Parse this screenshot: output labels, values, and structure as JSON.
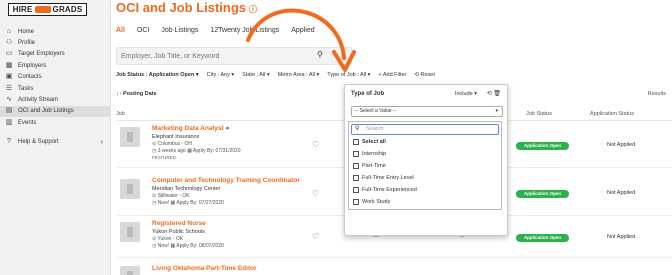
{
  "logo": {
    "left": "HIRE",
    "right": "GRADS"
  },
  "nav": [
    {
      "label": "Home",
      "icon": "⌂"
    },
    {
      "label": "Profile",
      "icon": "⚇"
    },
    {
      "label": "Target Employers",
      "icon": "▭"
    },
    {
      "label": "Employers",
      "icon": "▦"
    },
    {
      "label": "Contacts",
      "icon": "▣"
    },
    {
      "label": "Tasks",
      "icon": "☰"
    },
    {
      "label": "Activity Stream",
      "icon": "∿"
    },
    {
      "label": "OCI and Job Listings",
      "icon": "▤"
    },
    {
      "label": "Events",
      "icon": "▥"
    },
    {
      "label": "Help & Support",
      "icon": "?",
      "chevron": "›"
    }
  ],
  "page": {
    "title": "OCI and Job Listings",
    "info_icon": "ⓘ"
  },
  "tabs": [
    "All",
    "OCI",
    "Job Listings",
    "12Twenty Job Listings",
    "Applied"
  ],
  "search": {
    "placeholder": "Employer, Job Title, or Keyword"
  },
  "filters": {
    "job_status": "Job Status : Application Open ▾",
    "city": "City : Any ▾",
    "state": "State : All ▾",
    "metro": "Metro Area : All ▾",
    "type": "Type of Job : All ▾",
    "add": "+ Add Filter",
    "reset": "⟲ Reset"
  },
  "sort": {
    "label": "↓↑  Posting Date"
  },
  "results_label": "Results",
  "table": {
    "col_job": "Job",
    "col_job_status": "Job Status",
    "col_app_status": "Application Status"
  },
  "rows": [
    {
      "title": "Marketing Data Analyst",
      "employer": "Elephant Insurance",
      "location": "⊙ Columbus - OH",
      "meta": "◷ 3 weeks ago   ▦ Apply By: 07/31/2020",
      "badge": "FEATURED",
      "status": "Application Open",
      "applied": "Not Applied",
      "col2": "",
      "col3": ""
    },
    {
      "title": "Computer and Technology Training Coordinator",
      "employer": "Meridian Technology Center",
      "location": "⊙ Stillwater - OK",
      "meta": "◷ New!   ▦ Apply By: 07/27/2020",
      "badge": "",
      "status": "Application Open",
      "applied": "Not Applied",
      "col2": "",
      "col3": ""
    },
    {
      "title": "Registered Nurse",
      "employer": "Yukon Public Schools",
      "location": "⊙ Yukon - OK",
      "meta": "◷ New!   ▦ Apply By: 08/07/2020",
      "badge": "",
      "status": "Application Open",
      "applied": "Not Applied",
      "col2": "--",
      "col3": "--"
    },
    {
      "title": "Living Oklahoma Part-Time Editor",
      "employer": "",
      "location": "",
      "meta": "",
      "badge": "",
      "status": "",
      "applied": "",
      "col2": "",
      "col3": ""
    }
  ],
  "popup": {
    "title": "Type of Job",
    "include": "Include ▾",
    "icons": "⟲ 🗑",
    "select_placeholder": "-- Select a Value --",
    "caret": "▾",
    "search_placeholder": "Search",
    "options": [
      "Select all",
      "Internship",
      "Part-Time",
      "Full-Time Entry Level",
      "Full-Time Experienced",
      "Work Study"
    ]
  },
  "colors": {
    "accent": "#f06a1f",
    "status_green": "#2bb24c"
  }
}
